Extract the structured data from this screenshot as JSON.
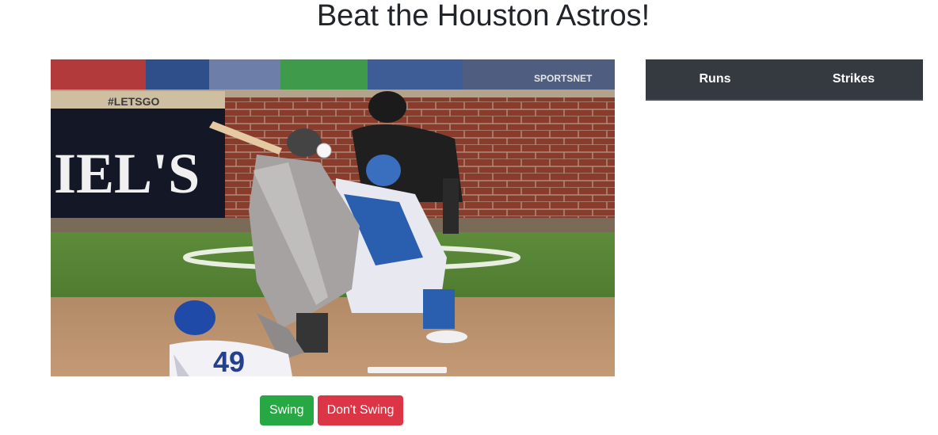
{
  "page": {
    "title": "Beat the Houston Astros!"
  },
  "video": {
    "broadcast_logo": "SPORTSNET",
    "wall_text_1": "#LETSGO",
    "wall_text_2": "IEL'S",
    "jersey_number": "49"
  },
  "controls": {
    "swing_label": "Swing",
    "dont_swing_label": "Don't Swing"
  },
  "scoreboard": {
    "headers": [
      "Runs",
      "Strikes"
    ]
  },
  "colors": {
    "swing": "#28a745",
    "dont_swing": "#dc3545",
    "table_header": "#343a40"
  }
}
